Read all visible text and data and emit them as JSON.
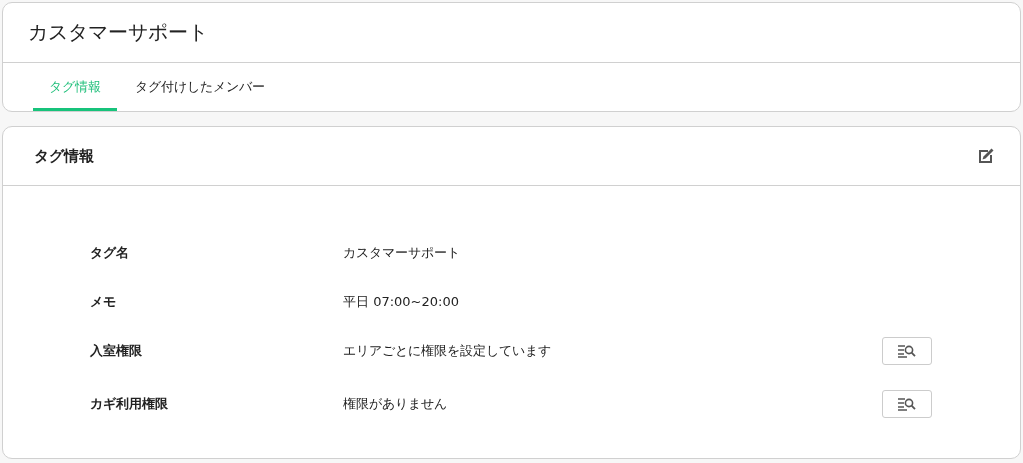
{
  "header": {
    "title": "カスタマーサポート"
  },
  "tabs": [
    {
      "label": "タグ情報",
      "selected": true
    },
    {
      "label": "タグ付けしたメンバー",
      "selected": false
    }
  ],
  "panel": {
    "title": "タグ情報",
    "rows": [
      {
        "label": "タグ名",
        "value": "カスタマーサポート",
        "detail_button": false
      },
      {
        "label": "メモ",
        "value": "平日 07:00~20:00",
        "detail_button": false
      },
      {
        "label": "入室権限",
        "value": "エリアごとに権限を設定しています",
        "detail_button": true
      },
      {
        "label": "カギ利用権限",
        "value": "権限がありません",
        "detail_button": true
      }
    ]
  }
}
